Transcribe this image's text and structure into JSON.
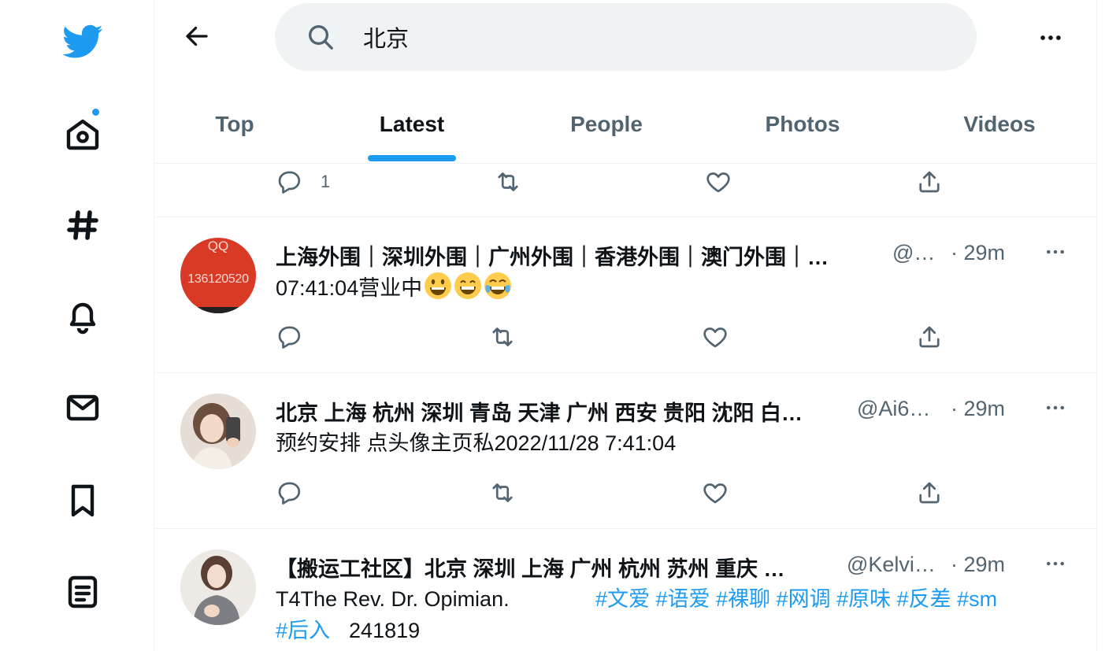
{
  "search": {
    "query": "北京"
  },
  "tabs": [
    {
      "label": "Top"
    },
    {
      "label": "Latest"
    },
    {
      "label": "People"
    },
    {
      "label": "Photos"
    },
    {
      "label": "Videos"
    }
  ],
  "partial_tweet": {
    "reply_count": "1"
  },
  "tweets": [
    {
      "name": "上海外围｜深圳外围｜广州外围｜香港外围｜澳门外围｜…",
      "handle": "@…",
      "time": "· 29m",
      "text": "07:41:04营业中",
      "avatar_text": "QQ",
      "avatar_number": "136120520"
    },
    {
      "name": "北京 上海 杭州 深圳 青岛 天津 广州 西安 贵阳 沈阳 白…",
      "handle": "@Ai6…",
      "time": "· 29m",
      "text": "预约安排 点头像主页私2022/11/28 7:41:04"
    },
    {
      "name": "【搬运工社区】北京 深圳 上海 广州 杭州 苏州 重庆 …",
      "handle": "@Kelvi…",
      "time": "· 29m",
      "text_line1": "T4The Rev. Dr. Opimian.",
      "hashtags_line1": "#文爱 #语爱 #裸聊 #网调 #原味 #反差 #sm",
      "hashtag_line2": "#后入",
      "number_line2": "241819"
    }
  ],
  "colors": {
    "accent": "#1d9bf0",
    "secondary_text": "#536471",
    "primary_text": "#0f1419"
  }
}
